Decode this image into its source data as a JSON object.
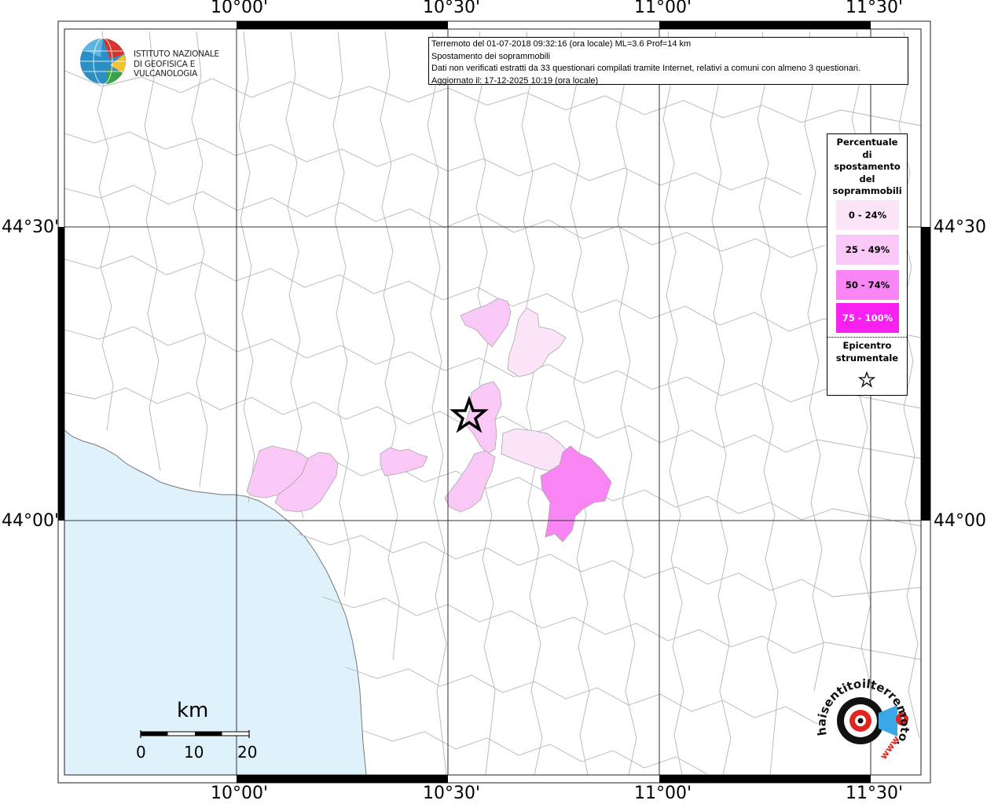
{
  "map": {
    "lon_labels": [
      "10°00'",
      "10°30'",
      "11°00'",
      "11°30'"
    ],
    "lat_labels": [
      "44°30'",
      "44°00'"
    ]
  },
  "logo": {
    "line1": "ISTITUTO NAZIONALE",
    "line2": "DI GEOFISICA E VULCANOLOGIA"
  },
  "info": {
    "line1": "Terremoto del 01-07-2018 09:32:16 (ora locale) ML=3.6 Prof=14 km",
    "line2": "Spostamento dei soprammobili",
    "line3": "Dati non verificati estratti da 33 questionari compilati tramite Internet, relativi a comuni con almeno 3 questionari.",
    "line4": "Aggiornato il: 17-12-2025 10:19 (ora locale)"
  },
  "legend": {
    "title_lines": [
      "Percentuale",
      "di",
      "spostamento",
      "del",
      "soprammobili"
    ],
    "classes": [
      {
        "label": "0 - 24%",
        "color": "#fbe3f8"
      },
      {
        "label": "25 - 49%",
        "color": "#fac8f6"
      },
      {
        "label": "50 - 74%",
        "color": "#f985f5"
      },
      {
        "label": "75 - 100%",
        "color": "#f81ff1"
      }
    ],
    "epicenter_lines": [
      "Epicentro",
      "strumentale"
    ]
  },
  "scale": {
    "unit": "km",
    "ticks": [
      "0",
      "10",
      "20"
    ]
  },
  "brand": {
    "text": "haisentitoilterremoto.it",
    "www": "www"
  },
  "colors": {
    "sea": "#dff1fb",
    "boundaries": "#b0b0b0",
    "grid": "#333333"
  }
}
